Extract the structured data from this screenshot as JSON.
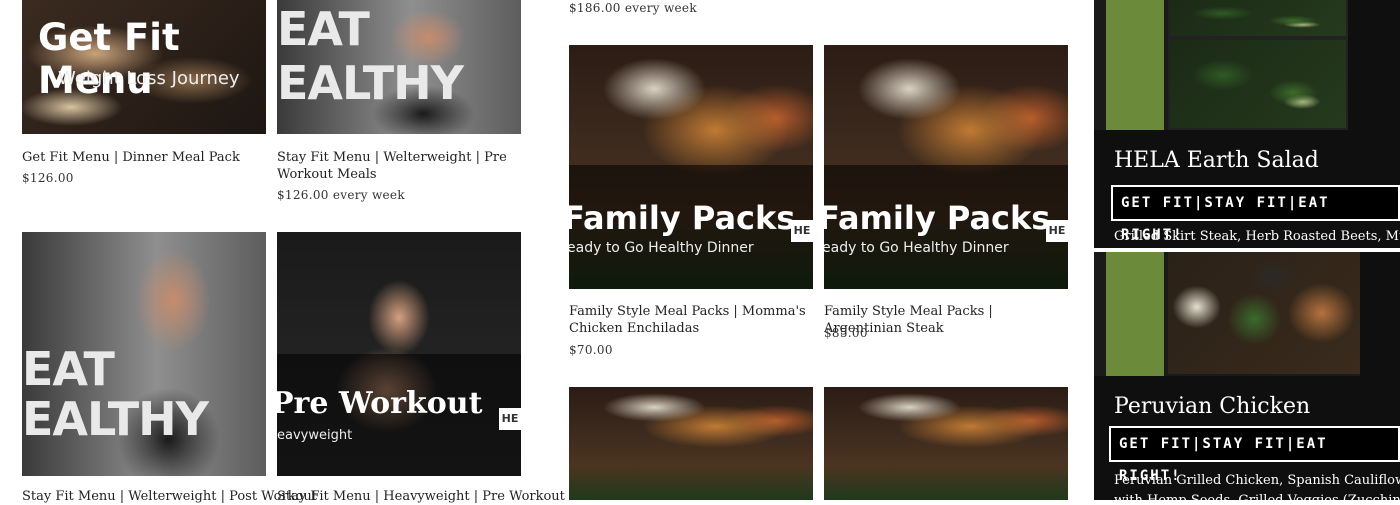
{
  "products": [
    {
      "title": "Get Fit Menu | Dinner Meal Pack",
      "price": "$126.00",
      "banner": "Get Fit Menu",
      "banner_sub": "Weight Loss Journey"
    },
    {
      "title": "Stay Fit Menu | Welterweight | Pre Workout Meals",
      "price": "$126.00 every week",
      "banner": "EAT",
      "banner2": "EALTHY"
    },
    {
      "title": "Family Style Meal Packs | Momma's Chicken Enchiladas",
      "price": "$70.00",
      "banner": "Family Packs",
      "banner_sub": "eady to Go Healthy Dinner"
    },
    {
      "title": "Family Style Meal Packs | Argentinian Steak",
      "price": "$85.00",
      "banner": "Family Packs",
      "banner_sub": "eady to Go Healthy Dinner"
    },
    {
      "title": "Stay Fit Menu | Welterweight | Post Workout",
      "banner": "EAT",
      "banner2": "EALTHY"
    },
    {
      "title": "Stay Fit Menu | Heavyweight | Pre Workout",
      "banner": "Pre Workout",
      "banner_sub": "eavyweight"
    }
  ],
  "top_price": "$186.00 every week",
  "badge_text": "HE",
  "panel": {
    "items": [
      {
        "name": "HELA Earth Salad",
        "tagline": "GET FIT|STAY FIT|EAT RIGHT!",
        "desc": "Grilled Skirt Steak, Herb Roasted Beets, Mushrooms,"
      },
      {
        "name": "Peruvian Chicken",
        "tagline": "GET FIT|STAY FIT|EAT RIGHT!",
        "desc": "Peruvian Grilled Chicken, Spanish Cauliflower Rice",
        "desc2": "with Hemp Seeds, Grilled Veggies (Zucchini, Squash"
      }
    ]
  }
}
